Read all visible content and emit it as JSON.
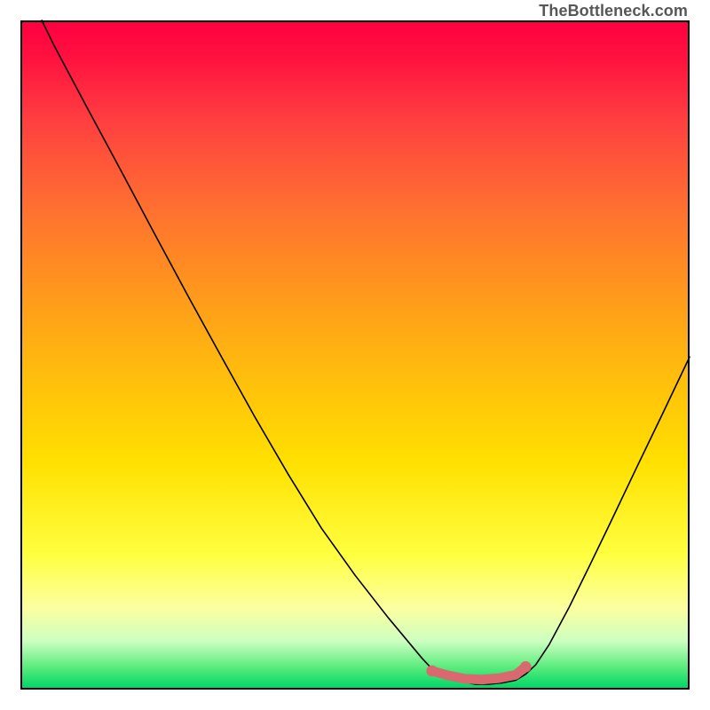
{
  "watermark": "TheBottleneck.com",
  "chart_data": {
    "type": "line",
    "title": "",
    "xlabel": "",
    "ylabel": "",
    "xlim": [
      0,
      100
    ],
    "ylim": [
      0,
      100
    ],
    "grid": false,
    "series": [
      {
        "name": "bottleneck-curve",
        "color": "#000000",
        "stroke_width": 1.6,
        "x": [
          3.2,
          5,
          10,
          15,
          20,
          25,
          30,
          35,
          40,
          45,
          50,
          55,
          60,
          61.5,
          63,
          65,
          68,
          70,
          72,
          74,
          75.5,
          77,
          79,
          82,
          85,
          88,
          92,
          96,
          100
        ],
        "y": [
          100,
          96.3,
          86.9,
          77.6,
          68.2,
          58.9,
          49.8,
          40.8,
          32.2,
          24.1,
          17.1,
          10.7,
          4.7,
          3.1,
          2.2,
          1.3,
          0.8,
          0.8,
          1.0,
          1.4,
          2.3,
          3.7,
          6.7,
          12.3,
          18.4,
          24.6,
          33,
          41.3,
          49.7
        ]
      }
    ],
    "marker": {
      "name": "optimal-range",
      "color": "#d9696e",
      "points_x": [
        61.5,
        64,
        66.5,
        69,
        71.5,
        74,
        75.5
      ],
      "points_y": [
        2.8,
        2.1,
        1.6,
        1.5,
        1.7,
        2.2,
        3.4
      ],
      "radius_scale": 0.9
    }
  }
}
